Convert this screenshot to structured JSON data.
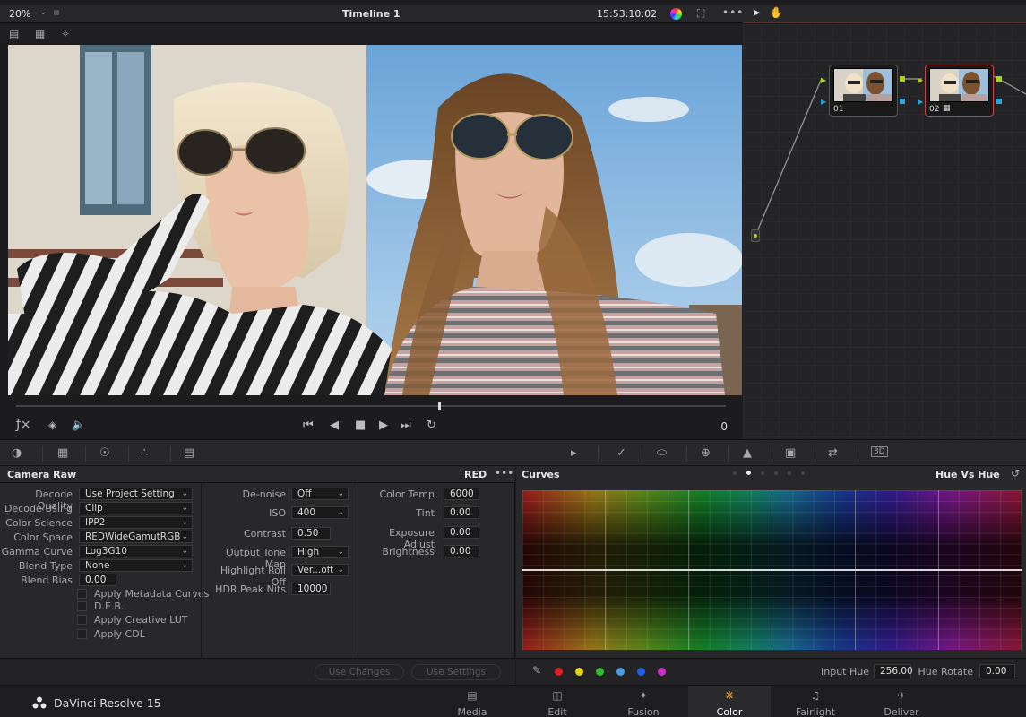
{
  "viewer": {
    "zoom": "20%",
    "timeline_name": "Timeline 1",
    "timecode": "15:53:10:02",
    "frame_count": "0"
  },
  "nodes": [
    {
      "label": "01"
    },
    {
      "label": "02"
    }
  ],
  "camera_raw": {
    "title": "Camera Raw",
    "source": "RED",
    "col1": [
      {
        "label": "Decode Quality",
        "value": "Use Project Setting"
      },
      {
        "label": "Decode Using",
        "value": "Clip"
      },
      {
        "label": "Color Science",
        "value": "IPP2"
      },
      {
        "label": "Color Space",
        "value": "REDWideGamutRGB"
      },
      {
        "label": "Gamma Curve",
        "value": "Log3G10"
      },
      {
        "label": "Blend Type",
        "value": "None"
      }
    ],
    "blend_bias": {
      "label": "Blend Bias",
      "value": "0.00"
    },
    "checkboxes": [
      "Apply Metadata Curves",
      "D.E.B.",
      "Apply Creative LUT",
      "Apply CDL"
    ],
    "col2": {
      "denoise": {
        "label": "De-noise",
        "value": "Off"
      },
      "iso": {
        "label": "ISO",
        "value": "400"
      },
      "contrast": {
        "label": "Contrast",
        "value": "0.50"
      },
      "output_tone_map": {
        "label": "Output Tone Map",
        "value": "High"
      },
      "highlight_roll_off": {
        "label": "Highlight Roll Off",
        "value": "Ver...oft"
      },
      "hdr_peak_nits": {
        "label": "HDR Peak Nits",
        "value": "10000"
      }
    },
    "col3": [
      {
        "label": "Color Temp",
        "value": "6000"
      },
      {
        "label": "Tint",
        "value": "0.00"
      },
      {
        "label": "Exposure Adjust",
        "value": "0.00"
      },
      {
        "label": "Brightness",
        "value": "0.00"
      }
    ],
    "use_changes": "Use Changes",
    "use_settings": "Use Settings"
  },
  "curves": {
    "title": "Curves",
    "mode": "Hue Vs Hue",
    "input_hue_label": "Input Hue",
    "input_hue_value": "256.00",
    "hue_rotate_label": "Hue Rotate",
    "hue_rotate_value": "0.00",
    "swatches": [
      "#e02020",
      "#e6d21c",
      "#2fc02f",
      "#4a9be0",
      "#1f5ee8",
      "#c72fc7"
    ]
  },
  "app": {
    "name": "DaVinci Resolve 15",
    "pages": [
      {
        "label": "Media",
        "icon": "media-icon"
      },
      {
        "label": "Edit",
        "icon": "edit-icon"
      },
      {
        "label": "Fusion",
        "icon": "fusion-icon"
      },
      {
        "label": "Color",
        "icon": "color-icon",
        "active": true
      },
      {
        "label": "Fairlight",
        "icon": "fairlight-icon"
      },
      {
        "label": "Deliver",
        "icon": "deliver-icon"
      }
    ]
  }
}
